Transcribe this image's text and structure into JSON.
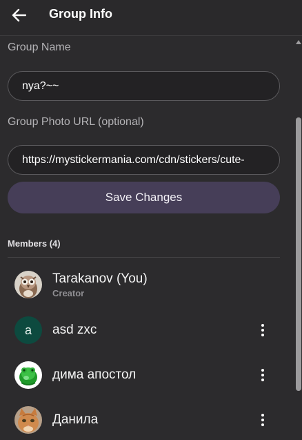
{
  "header": {
    "title": "Group Info",
    "back_icon": "arrow-left-icon"
  },
  "form": {
    "group_name_label": "Group Name",
    "group_name_value": "nya?~~",
    "photo_url_label": "Group Photo URL (optional)",
    "photo_url_value": "https://mystickermania.com/cdn/stickers/cute-",
    "save_label": "Save Changes"
  },
  "members": {
    "title": "Members (4)",
    "list": [
      {
        "name": "Tarakanov (You)",
        "role": "Creator",
        "avatar": "owl-photo-avatar",
        "has_menu": false
      },
      {
        "name": "asd zxc",
        "role": "",
        "avatar": "letter-avatar",
        "avatar_letter": "a",
        "has_menu": true
      },
      {
        "name": "дима апостол",
        "role": "",
        "avatar": "green-frog-avatar",
        "has_menu": true
      },
      {
        "name": "Данила",
        "role": "",
        "avatar": "cat-photo-avatar",
        "has_menu": true
      }
    ]
  },
  "colors": {
    "background": "#2c2b2d",
    "accent_button": "#463e58",
    "letter_avatar": "#0d4a3f"
  }
}
